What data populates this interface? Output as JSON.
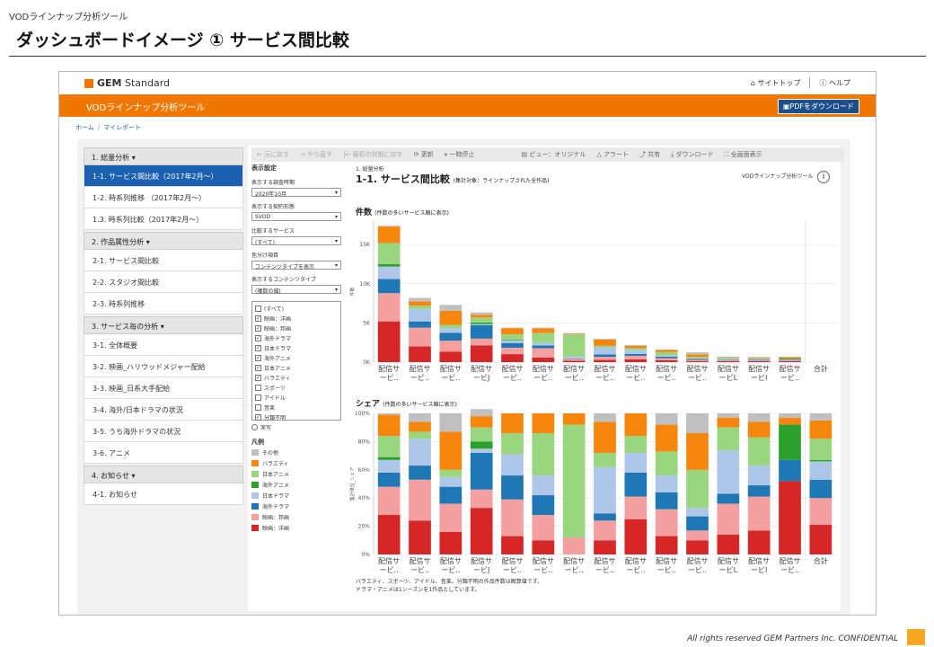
{
  "slide": {
    "subtitle": "VODラインナップ分析ツール",
    "title": "ダッシュボードイメージ ① サービス間比較",
    "footer": "All rights reserved GEM Partners Inc. CONFIDENTIAL"
  },
  "app": {
    "logo_bold": "GEM",
    "logo_light": " Standard",
    "site_top": "サイトトップ",
    "help": "ヘルプ",
    "header_title": "VODラインナップ分析ツール",
    "pdf_button": "PDFをダウンロード",
    "breadcrumb": [
      "ホーム",
      "マイレポート"
    ]
  },
  "sidebar": [
    {
      "type": "header",
      "label": "1. 総量分析 ▾"
    },
    {
      "type": "item",
      "label": "1-1. サービス間比較（2017年2月～）",
      "active": true
    },
    {
      "type": "item",
      "label": "1-2. 時系列推移 （2017年2月～）"
    },
    {
      "type": "item",
      "label": "1.3. 時系列比較（2017年2月～）"
    },
    {
      "type": "header",
      "label": "2. 作品属性分析 ▾"
    },
    {
      "type": "item",
      "label": "2-1. サービス間比較"
    },
    {
      "type": "item",
      "label": "2-2. スタジオ間比較"
    },
    {
      "type": "item",
      "label": "2-3. 時系列推移"
    },
    {
      "type": "header",
      "label": "3. サービス毎の分析 ▾"
    },
    {
      "type": "item",
      "label": "3-1. 全体概要"
    },
    {
      "type": "item",
      "label": "3-2. 映画_ハリウッドメジャー配給"
    },
    {
      "type": "item",
      "label": "3-3. 映画_日系大手配給"
    },
    {
      "type": "item",
      "label": "3-4. 海外/日本ドラマの状況"
    },
    {
      "type": "item",
      "label": "3-5. うち海外ドラマの状況"
    },
    {
      "type": "item",
      "label": "3-6. アニメ"
    },
    {
      "type": "header",
      "label": "4. お知らせ ▾"
    },
    {
      "type": "item",
      "label": "4-1. お知らせ"
    }
  ],
  "toolbar": {
    "undo": "← 元に戻す",
    "redo": "→ やり直す",
    "reset": "|← 最初の状態に戻す",
    "refresh": "更新",
    "pause": "一時停止",
    "view": "ビュー：オリジナル",
    "alert": "アラート",
    "share": "共有",
    "download": "ダウンロード",
    "fullscreen": "全画面表示"
  },
  "filters": {
    "section": "表示設定",
    "period_label": "表示する調査時期",
    "period_value": "2020年10月",
    "contract_label": "表示する契約形態",
    "contract_value": "SVOD",
    "service_label": "比較するサービス",
    "service_value": "(すべて)",
    "color_label": "色分け項目",
    "color_value": "コンテンツタイプを表示",
    "content_label": "表示するコンテンツタイプ",
    "content_value": "(複数の値)",
    "checkboxes": [
      {
        "label": "(すべて)",
        "checked": false
      },
      {
        "label": "映画：洋画",
        "checked": true
      },
      {
        "label": "映画：邦画",
        "checked": true
      },
      {
        "label": "海外ドラマ",
        "checked": true
      },
      {
        "label": "日本ドラマ",
        "checked": true
      },
      {
        "label": "海外アニメ",
        "checked": true
      },
      {
        "label": "日本アニメ",
        "checked": true
      },
      {
        "label": "バラエティ",
        "checked": true
      },
      {
        "label": "スポーツ",
        "checked": false
      },
      {
        "label": "アイドル",
        "checked": false
      },
      {
        "label": "音楽",
        "checked": false
      },
      {
        "label": "分類不明",
        "checked": true
      }
    ],
    "radio": "実写",
    "legend_title": "凡例"
  },
  "legend": [
    {
      "label": "その他",
      "color": "#c0c0c0"
    },
    {
      "label": "バラエティ",
      "color": "#f7860f"
    },
    {
      "label": "日本アニメ",
      "color": "#9ad57f"
    },
    {
      "label": "海外アニメ",
      "color": "#2ca02c"
    },
    {
      "label": "日本ドラマ",
      "color": "#aec7e8"
    },
    {
      "label": "海外ドラマ",
      "color": "#1f77b4"
    },
    {
      "label": "映画：邦画",
      "color": "#f4a0a0"
    },
    {
      "label": "映画：洋画",
      "color": "#d62728"
    }
  ],
  "report": {
    "crumb": "1. 総量分析",
    "brand": "VODラインナップ分析ツール",
    "title": "1-1. サービス間比較",
    "title_note": "(集計対象：ラインナップされた全作品)",
    "count_title": "件数",
    "count_note": "(件数の多いサービス順に表示)",
    "share_title": "シェア",
    "share_note": "(件数の多いサービス順に表示)",
    "count_ylabel": "件数",
    "share_ylabel": "集計単位_シェア",
    "note1": "バラエティ、スポーツ、アイドル、音楽、分類不明の作品件数は概算値です。",
    "note2": "ドラマ・アニメは1シーズンを1作品としています。"
  },
  "chart_data": [
    {
      "type": "bar",
      "stacked": true,
      "title": "件数",
      "ylabel": "件数",
      "ylim": [
        0,
        18000
      ],
      "yticks": [
        "0K",
        "5K",
        "10K",
        "15K"
      ],
      "categories": [
        "配信サ ービ..",
        "配信サ ービ..",
        "配信サ ービ..",
        "配信サ ービJ",
        "配信サ ービ..",
        "配信サ ービ..",
        "配信サ ービ..",
        "配信サ ービ..",
        "配信サ ービ..",
        "配信サ ービ..",
        "配信サ ービ..",
        "配信サ ービL",
        "配信サ ービI",
        "配信サ ービ..",
        "合計"
      ],
      "series": [
        {
          "name": "映画：洋画",
          "values": [
            5200,
            2000,
            1350,
            2150,
            1020,
            600,
            180,
            280,
            360,
            250,
            130,
            120,
            120,
            130
          ]
        },
        {
          "name": "映画：邦画",
          "values": [
            3600,
            2400,
            1400,
            850,
            820,
            1180,
            240,
            400,
            450,
            250,
            160,
            120,
            100,
            80
          ]
        },
        {
          "name": "海外ドラマ",
          "values": [
            1800,
            800,
            1000,
            1700,
            600,
            350,
            50,
            300,
            250,
            200,
            130,
            60,
            70,
            60
          ]
        },
        {
          "name": "日本ドラマ",
          "values": [
            1600,
            1600,
            600,
            150,
            340,
            330,
            260,
            900,
            500,
            150,
            70,
            150,
            120,
            90
          ]
        },
        {
          "name": "海外アニメ",
          "values": [
            300,
            0,
            0,
            200,
            80,
            0,
            0,
            0,
            0,
            0,
            0,
            0,
            0,
            100
          ]
        },
        {
          "name": "日本アニメ",
          "values": [
            2700,
            400,
            400,
            650,
            700,
            1250,
            2800,
            200,
            230,
            450,
            200,
            120,
            100,
            0
          ]
        },
        {
          "name": "バラエティ",
          "values": [
            2100,
            550,
            1800,
            350,
            780,
            600,
            100,
            800,
            300,
            250,
            300,
            50,
            80,
            160
          ]
        },
        {
          "name": "その他",
          "values": [
            100,
            450,
            750,
            300,
            60,
            90,
            70,
            100,
            100,
            50,
            260,
            80,
            80,
            80
          ]
        }
      ]
    },
    {
      "type": "bar",
      "stacked": true,
      "title": "シェア",
      "ylabel": "集計単位_シェア",
      "ylim": [
        0,
        100
      ],
      "yticks": [
        "0%",
        "20%",
        "40%",
        "60%",
        "80%",
        "100%"
      ],
      "categories": [
        "配信サ ービ..",
        "配信サ ービ..",
        "配信サ ービ..",
        "配信サ ービJ",
        "配信サ ービ..",
        "配信サ ービ..",
        "配信サ ービ..",
        "配信サ ービ..",
        "配信サ ービ..",
        "配信サ ービ..",
        "配信サ ービ..",
        "配信サ ービL",
        "配信サ ービI",
        "配信サ ービ..",
        "合計"
      ],
      "series": [
        {
          "name": "映画：洋画",
          "values": [
            28,
            24,
            16,
            33,
            13,
            10,
            0,
            10,
            25,
            13,
            10,
            14,
            17,
            52,
            21
          ]
        },
        {
          "name": "映画：邦画",
          "values": [
            20,
            29,
            20,
            13,
            26,
            18,
            12,
            14,
            16,
            19,
            7,
            22,
            24,
            0,
            19
          ]
        },
        {
          "name": "海外ドラマ",
          "values": [
            10,
            10,
            12,
            26,
            17,
            14,
            0,
            5,
            17,
            12,
            10,
            7,
            8,
            15,
            13
          ]
        },
        {
          "name": "日本ドラマ",
          "values": [
            9,
            19,
            7,
            3,
            15,
            14,
            0,
            33,
            14,
            12,
            6,
            31,
            14,
            0,
            13
          ]
        },
        {
          "name": "海外アニメ",
          "values": [
            2,
            0,
            0,
            5,
            0,
            0,
            0,
            0,
            0,
            0,
            0,
            0,
            0,
            25,
            1
          ]
        },
        {
          "name": "日本アニメ",
          "values": [
            15,
            5,
            5,
            10,
            15,
            30,
            80,
            10,
            12,
            17,
            27,
            16,
            20,
            0,
            15
          ]
        },
        {
          "name": "バラエティ",
          "values": [
            15,
            7,
            27,
            8,
            14,
            14,
            8,
            22,
            16,
            19,
            26,
            7,
            11,
            5,
            13
          ]
        },
        {
          "name": "その他",
          "values": [
            1,
            6,
            13,
            5,
            0,
            0,
            0,
            6,
            0,
            8,
            14,
            3,
            6,
            3,
            5
          ]
        }
      ]
    }
  ]
}
